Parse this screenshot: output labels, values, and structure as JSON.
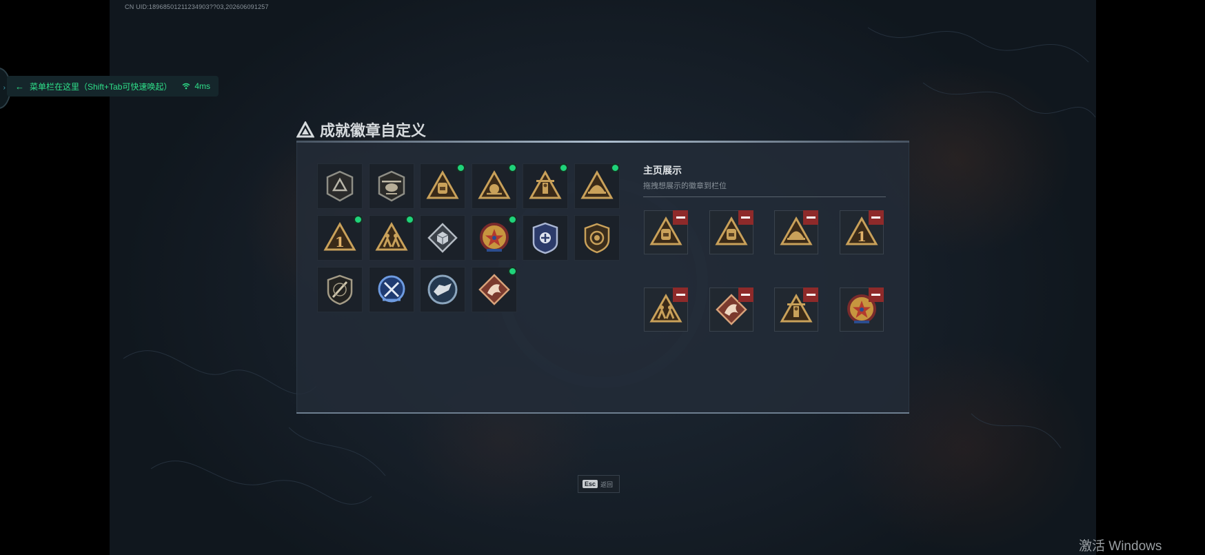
{
  "uid": "CN UID:18968501211234903??03,202606091257",
  "menu_bar": {
    "hint": "菜单栏在这里（Shift+Tab可快速唤起）",
    "ping": "4ms"
  },
  "panel": {
    "title": "成就徽章自定义"
  },
  "badges": [
    {
      "icon": "hexagon-shield-badge-icon",
      "new": false
    },
    {
      "icon": "helicopter-badge-icon",
      "new": false
    },
    {
      "icon": "backpack-triangle-badge-icon",
      "new": true
    },
    {
      "icon": "sun-triangle-badge-icon",
      "new": true
    },
    {
      "icon": "tower-triangle-badge-icon",
      "new": true
    },
    {
      "icon": "helmet-triangle-badge-icon",
      "new": true
    },
    {
      "icon": "number-one-triangle-badge-icon",
      "new": true
    },
    {
      "icon": "soldiers-triangle-badge-icon",
      "new": true
    },
    {
      "icon": "silver-cube-badge-icon",
      "new": false
    },
    {
      "icon": "star-medal-badge-icon",
      "new": true
    },
    {
      "icon": "blue-police-badge-icon",
      "new": false
    },
    {
      "icon": "lion-shield-badge-icon",
      "new": false
    },
    {
      "icon": "sword-shield-badge-icon",
      "new": false
    },
    {
      "icon": "blue-swords-badge-icon",
      "new": false
    },
    {
      "icon": "wolf-disk-badge-icon",
      "new": false
    },
    {
      "icon": "dragon-diamond-badge-icon",
      "new": true
    }
  ],
  "showcase": {
    "title": "主页展示",
    "subtitle": "拖拽想展示的徽章到栏位",
    "slots": [
      "backpack-triangle-badge-icon",
      "backpack-triangle-badge-icon",
      "helmet-triangle-badge-icon",
      "number-one-triangle-badge-icon",
      "soldiers-triangle-badge-icon",
      "dragon-diamond-badge-icon",
      "tower-triangle-badge-icon",
      "star-medal-badge-icon"
    ]
  },
  "esc": {
    "key": "Esc",
    "label": "返回"
  },
  "watermark": "激活 Windows",
  "colors": {
    "accent_green": "#1fd37a",
    "remove_red": "#8e2a2a",
    "gold": "#c9a15a"
  }
}
